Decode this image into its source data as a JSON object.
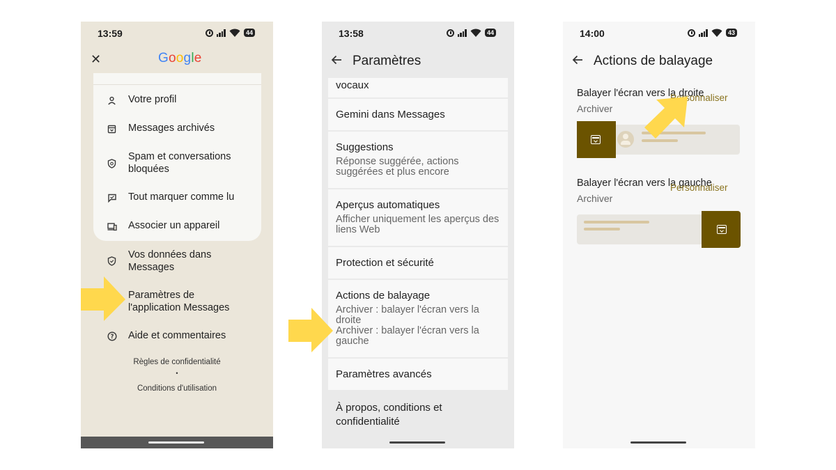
{
  "colors": {
    "accent_brown": "#6b5300",
    "highlight_yellow": "#ffd84d",
    "customize_gold": "#8a7420"
  },
  "phone1": {
    "status": {
      "time": "13:59",
      "battery": "44"
    },
    "header": {
      "close_icon": "close-icon",
      "logo": [
        "G",
        "o",
        "o",
        "g",
        "l",
        "e"
      ]
    },
    "menu": [
      {
        "label": "Votre profil",
        "icon": "person-icon"
      },
      {
        "label": "Messages archivés",
        "icon": "archive-icon"
      },
      {
        "label": "Spam et conversations bloquées",
        "icon": "shield-icon"
      },
      {
        "label": "Tout marquer comme lu",
        "icon": "chat-check-icon"
      },
      {
        "label": "Associer un appareil",
        "icon": "devices-icon"
      },
      {
        "label": "Vos données dans Messages",
        "icon": "shield-data-icon"
      },
      {
        "label": "Paramètres de l'application Messages",
        "icon": "settings-icon"
      },
      {
        "label": "Aide et commentaires",
        "icon": "help-icon"
      }
    ],
    "legal": {
      "privacy": "Règles de confidentialité",
      "dot": "•",
      "terms": "Conditions d'utilisation"
    }
  },
  "phone2": {
    "status": {
      "time": "13:58",
      "battery": "44"
    },
    "title": "Paramètres",
    "items": [
      {
        "title": "vocaux"
      },
      {
        "title": "Gemini dans Messages"
      },
      {
        "title": "Suggestions",
        "subtitle": "Réponse suggérée, actions suggérées et plus encore"
      },
      {
        "title": "Aperçus automatiques",
        "subtitle": "Afficher uniquement les aperçus des liens Web"
      },
      {
        "title": "Protection et sécurité"
      },
      {
        "title": "Actions de balayage",
        "subtitle": "Archiver : balayer l'écran vers la droite",
        "subtitle2": "Archiver : balayer l'écran vers la gauche"
      },
      {
        "title": "Paramètres avancés"
      },
      {
        "title": "À propos, conditions et confidentialité"
      }
    ]
  },
  "phone3": {
    "status": {
      "time": "14:00",
      "battery": "43"
    },
    "title": "Actions de balayage",
    "right_swipe": {
      "label": "Balayer l'écran vers la droite",
      "action": "Archiver",
      "customize": "Personnaliser"
    },
    "left_swipe": {
      "label": "Balayer l'écran vers la gauche",
      "action": "Archiver",
      "customize": "Personnaliser"
    }
  }
}
